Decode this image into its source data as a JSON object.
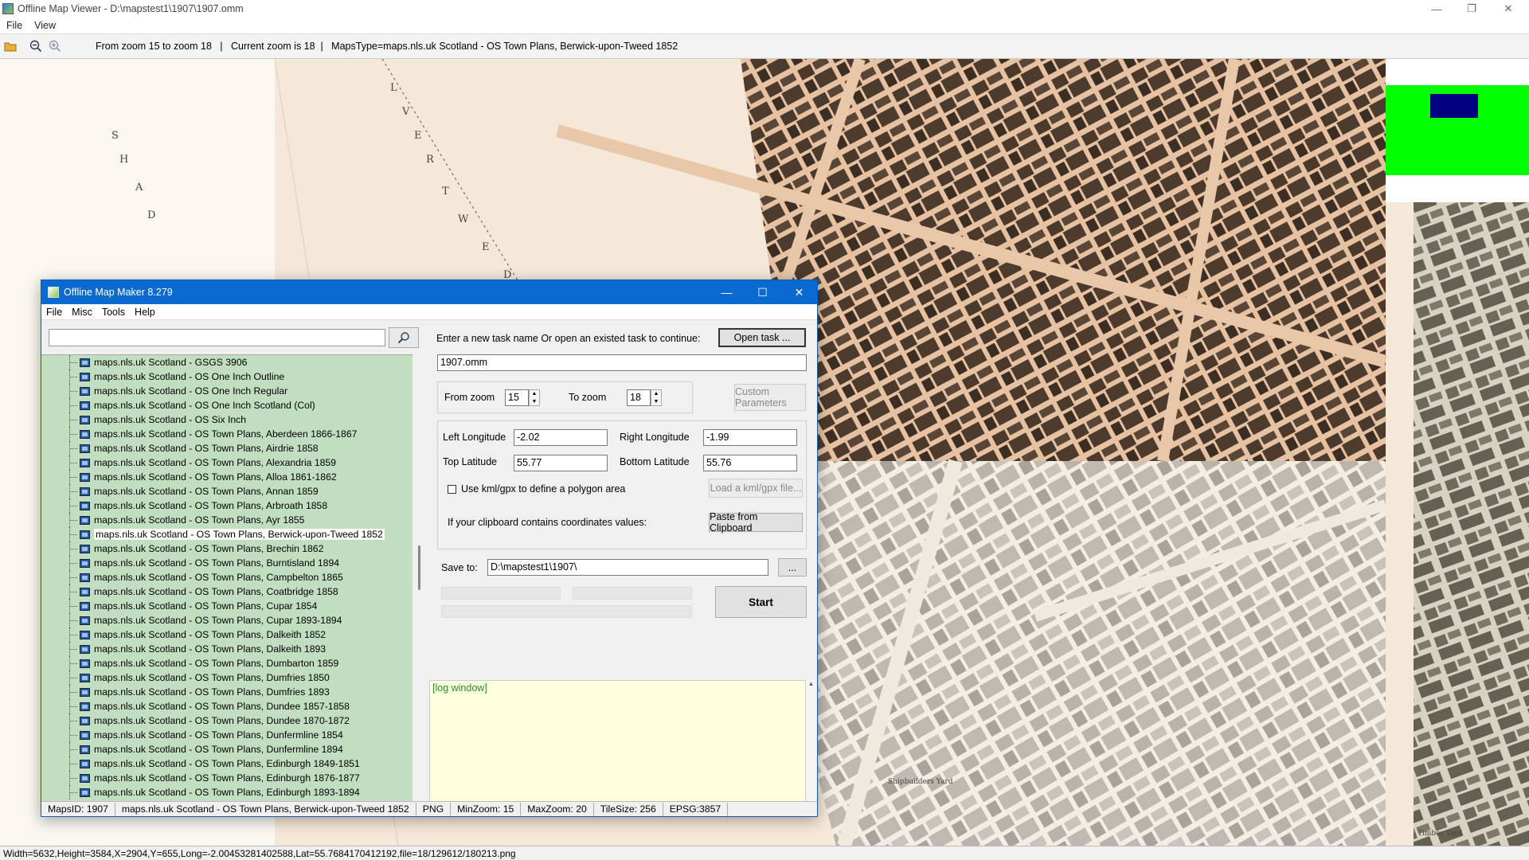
{
  "viewer": {
    "title": "Offline Map Viewer - D:\\mapstest1\\1907\\1907.omm",
    "menu": [
      "File",
      "View"
    ],
    "toolbar_info": "From zoom 15 to zoom 18   |   Current zoom is 18  |   MapsType=maps.nls.uk Scotland - OS Town Plans, Berwick-upon-Tweed 1852",
    "status": "Width=5632,Height=3584,X=2904,Y=655,Long=-2.00453281402588,Lat=55.7684170412192,file=18/129612/180213.png"
  },
  "map": {
    "labels": [
      "S",
      "H",
      "A",
      "D",
      "L",
      "V",
      "E",
      "R",
      "T",
      "W",
      "E",
      "D",
      "Shipbuilders Yard",
      "Timber Yard"
    ],
    "overview_colors": {
      "frame": "#00ff00",
      "viewport": "#000080"
    }
  },
  "dialog": {
    "title": "Offline Map Maker 8.279",
    "menu": [
      "File",
      "Misc",
      "Tools",
      "Help"
    ],
    "search_placeholder": "",
    "tree_items": [
      "maps.nls.uk Scotland - GSGS 3906",
      "maps.nls.uk Scotland - OS One Inch Outline",
      "maps.nls.uk Scotland - OS One Inch Regular",
      "maps.nls.uk Scotland - OS One Inch Scotland (Col)",
      "maps.nls.uk Scotland - OS Six Inch",
      "maps.nls.uk Scotland - OS Town Plans, Aberdeen 1866-1867",
      "maps.nls.uk Scotland - OS Town Plans, Airdrie 1858",
      "maps.nls.uk Scotland - OS Town Plans, Alexandria 1859",
      "maps.nls.uk Scotland - OS Town Plans, Alloa 1861-1862",
      "maps.nls.uk Scotland - OS Town Plans, Annan 1859",
      "maps.nls.uk Scotland - OS Town Plans, Arbroath 1858",
      "maps.nls.uk Scotland - OS Town Plans, Ayr 1855",
      "maps.nls.uk Scotland - OS Town Plans, Berwick-upon-Tweed 1852",
      "maps.nls.uk Scotland - OS Town Plans, Brechin 1862",
      "maps.nls.uk Scotland - OS Town Plans, Burntisland 1894",
      "maps.nls.uk Scotland - OS Town Plans, Campbelton 1865",
      "maps.nls.uk Scotland - OS Town Plans, Coatbridge 1858",
      "maps.nls.uk Scotland - OS Town Plans, Cupar 1854",
      "maps.nls.uk Scotland - OS Town Plans, Cupar 1893-1894",
      "maps.nls.uk Scotland - OS Town Plans, Dalkeith 1852",
      "maps.nls.uk Scotland - OS Town Plans, Dalkeith 1893",
      "maps.nls.uk Scotland - OS Town Plans, Dumbarton 1859",
      "maps.nls.uk Scotland - OS Town Plans, Dumfries 1850",
      "maps.nls.uk Scotland - OS Town Plans, Dumfries 1893",
      "maps.nls.uk Scotland - OS Town Plans, Dundee 1857-1858",
      "maps.nls.uk Scotland - OS Town Plans, Dundee 1870-1872",
      "maps.nls.uk Scotland - OS Town Plans, Dunfermline 1854",
      "maps.nls.uk Scotland - OS Town Plans, Dunfermline 1894",
      "maps.nls.uk Scotland - OS Town Plans, Edinburgh 1849-1851",
      "maps.nls.uk Scotland - OS Town Plans, Edinburgh 1876-1877",
      "maps.nls.uk Scotland - OS Town Plans, Edinburgh 1893-1894"
    ],
    "selected_index": 12,
    "task_prompt": "Enter a new task name Or open an existed task to continue:",
    "open_task_label": "Open task ...",
    "task_name": "1907.omm",
    "from_zoom_label": "From zoom",
    "from_zoom": "15",
    "to_zoom_label": "To zoom",
    "to_zoom": "18",
    "custom_params_label": "Custom Parameters",
    "left_long_label": "Left Longitude",
    "left_long": "-2.02",
    "right_long_label": "Right Longitude",
    "right_long": "-1.99",
    "top_lat_label": "Top Latitude",
    "top_lat": "55.77",
    "bottom_lat_label": "Bottom Latitude",
    "bottom_lat": "55.76",
    "kml_label": "Use kml/gpx to define a polygon area",
    "load_kml_label": "Load a kml/gpx file...",
    "clipboard_prompt": "If your clipboard contains coordinates values:",
    "paste_label": "Paste from Clipboard",
    "save_to_label": "Save to:",
    "save_to": "D:\\mapstest1\\1907\\",
    "browse_label": "...",
    "start_label": "Start",
    "log_text": "[log window]",
    "status": {
      "maps_id": "MapsID: 1907",
      "maps_name": "maps.nls.uk Scotland - OS Town Plans, Berwick-upon-Tweed 1852",
      "format": "PNG",
      "min_zoom": "MinZoom: 15",
      "max_zoom": "MaxZoom: 20",
      "tile_size": "TileSize: 256",
      "epsg": "EPSG:3857"
    }
  }
}
